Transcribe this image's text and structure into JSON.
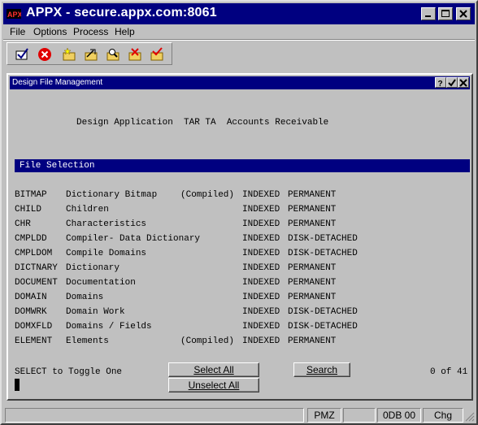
{
  "window": {
    "title": "APPX - secure.appx.com:8061"
  },
  "menu": [
    "File",
    "Options",
    "Process",
    "Help"
  ],
  "toolbar": [
    "check-icon",
    "cancel-icon",
    "new-folder-icon",
    "edit-folder-icon",
    "find-folder-icon",
    "delete-folder-icon",
    "folder-check-icon"
  ],
  "child": {
    "title": "Design File Management",
    "heading": "Design Application  TAR TA  Accounts Receivable",
    "section": "File Selection",
    "rows": [
      {
        "code": "BITMAP",
        "desc": "Dictionary Bitmap",
        "flag": "(Compiled)",
        "org": "INDEXED",
        "type": "PERMANENT"
      },
      {
        "code": "CHILD",
        "desc": "Children",
        "flag": "",
        "org": "INDEXED",
        "type": "PERMANENT"
      },
      {
        "code": "CHR",
        "desc": "Characteristics",
        "flag": "",
        "org": "INDEXED",
        "type": "PERMANENT"
      },
      {
        "code": "CMPLDD",
        "desc": "Compiler- Data Dictionary",
        "flag": "",
        "org": "INDEXED",
        "type": "DISK-DETACHED"
      },
      {
        "code": "CMPLDOM",
        "desc": "Compile Domains",
        "flag": "",
        "org": "INDEXED",
        "type": "DISK-DETACHED"
      },
      {
        "code": "DICTNARY",
        "desc": "Dictionary",
        "flag": "",
        "org": "INDEXED",
        "type": "PERMANENT"
      },
      {
        "code": "DOCUMENT",
        "desc": "Documentation",
        "flag": "",
        "org": "INDEXED",
        "type": "PERMANENT"
      },
      {
        "code": "DOMAIN",
        "desc": "Domains",
        "flag": "",
        "org": "INDEXED",
        "type": "PERMANENT"
      },
      {
        "code": "DOMWRK",
        "desc": "Domain Work",
        "flag": "",
        "org": "INDEXED",
        "type": "DISK-DETACHED"
      },
      {
        "code": "DOMXFLD",
        "desc": "Domains / Fields",
        "flag": "",
        "org": "INDEXED",
        "type": "DISK-DETACHED"
      },
      {
        "code": "ELEMENT",
        "desc": "Elements",
        "flag": "(Compiled)",
        "org": "INDEXED",
        "type": "PERMANENT"
      }
    ],
    "hint": "SELECT to Toggle One",
    "select_all": "Select All",
    "unselect_all": "Unselect All",
    "search": "Search",
    "count": "0 of 41"
  },
  "status": {
    "p1": "",
    "p2": "PMZ",
    "p3": "",
    "p4": "0DB 00",
    "p5": "Chg"
  }
}
